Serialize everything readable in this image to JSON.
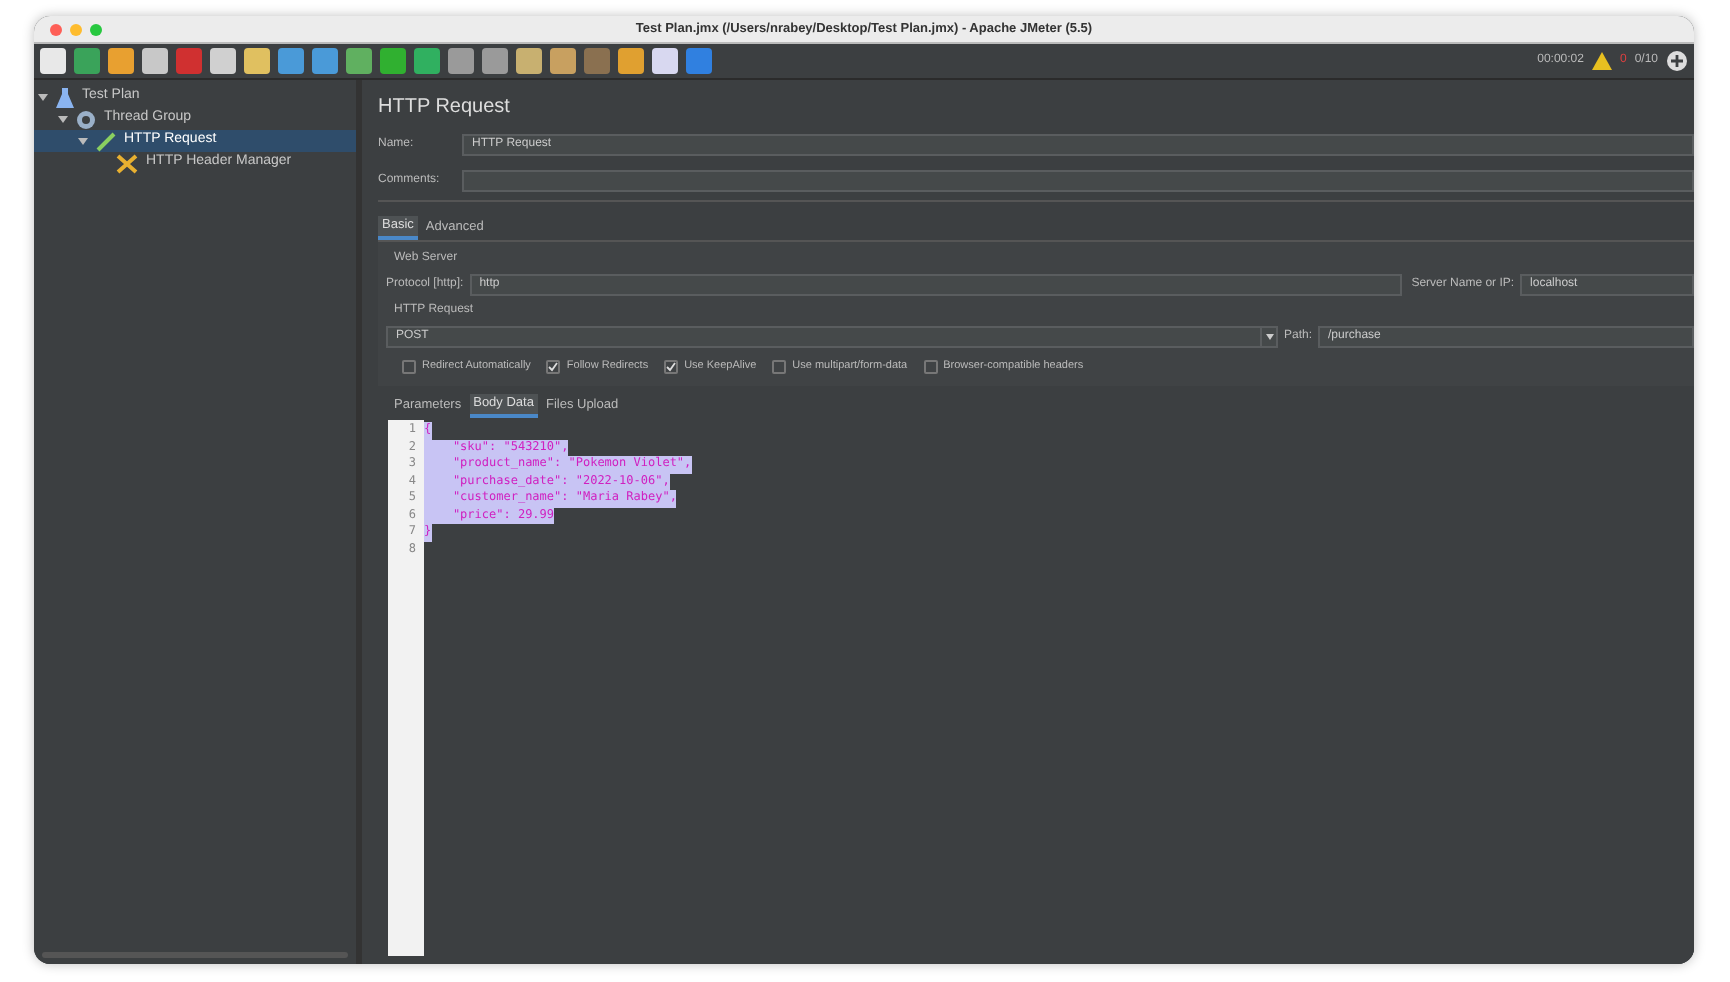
{
  "window": {
    "title": "Test Plan.jmx (/Users/nrabey/Desktop/Test Plan.jmx) - Apache JMeter (5.5)"
  },
  "status": {
    "elapsed": "00:00:02",
    "errors": "0",
    "threads": "0/10"
  },
  "tree": [
    {
      "label": "Test Plan",
      "kind": "plan",
      "expanded": true,
      "selected": false,
      "children": [
        {
          "label": "Thread Group",
          "kind": "group",
          "expanded": true,
          "selected": false,
          "children": [
            {
              "label": "HTTP Request",
              "kind": "sampler",
              "expanded": true,
              "selected": true,
              "children": [
                {
                  "label": "HTTP Header Manager",
                  "kind": "config",
                  "selected": false
                }
              ]
            }
          ]
        }
      ]
    }
  ],
  "panel": {
    "title": "HTTP Request",
    "name_label": "Name:",
    "name_value": "HTTP Request",
    "comments_label": "Comments:",
    "tabs": [
      {
        "label": "Basic",
        "selected": true
      },
      {
        "label": "Advanced",
        "selected": false
      }
    ],
    "web_server": {
      "legend": "Web Server",
      "protocol_label": "Protocol [http]:",
      "protocol_value": "http",
      "server_label": "Server Name or IP:",
      "server_value": "localhost"
    },
    "http_request": {
      "legend": "HTTP Request",
      "method": "POST",
      "path_label": "Path:",
      "path_value": "/purchase"
    },
    "options": [
      {
        "label": "Redirect Automatically",
        "checked": false
      },
      {
        "label": "Follow Redirects",
        "checked": true
      },
      {
        "label": "Use KeepAlive",
        "checked": true
      },
      {
        "label": "Use multipart/form-data",
        "checked": false
      },
      {
        "label": "Browser-compatible headers",
        "checked": false
      }
    ],
    "subtabs": [
      {
        "label": "Parameters",
        "selected": false
      },
      {
        "label": "Body Data",
        "selected": true
      },
      {
        "label": "Files Upload",
        "selected": false
      }
    ],
    "body_lines": [
      {
        "number": "1",
        "text": "{",
        "selected": true
      },
      {
        "number": "2",
        "text": "    \"sku\": \"543210\",",
        "selected": true
      },
      {
        "number": "3",
        "text": "    \"product_name\": \"Pokemon Violet\",",
        "selected": true
      },
      {
        "number": "4",
        "text": "    \"purchase_date\": \"2022-10-06\",",
        "selected": true
      },
      {
        "number": "5",
        "text": "    \"customer_name\": \"Maria Rabey\",",
        "selected": true
      },
      {
        "number": "6",
        "text": "    \"price\": 29.99",
        "selected": true
      },
      {
        "number": "7",
        "text": "}",
        "selected": true
      },
      {
        "number": "8"
      }
    ]
  }
}
